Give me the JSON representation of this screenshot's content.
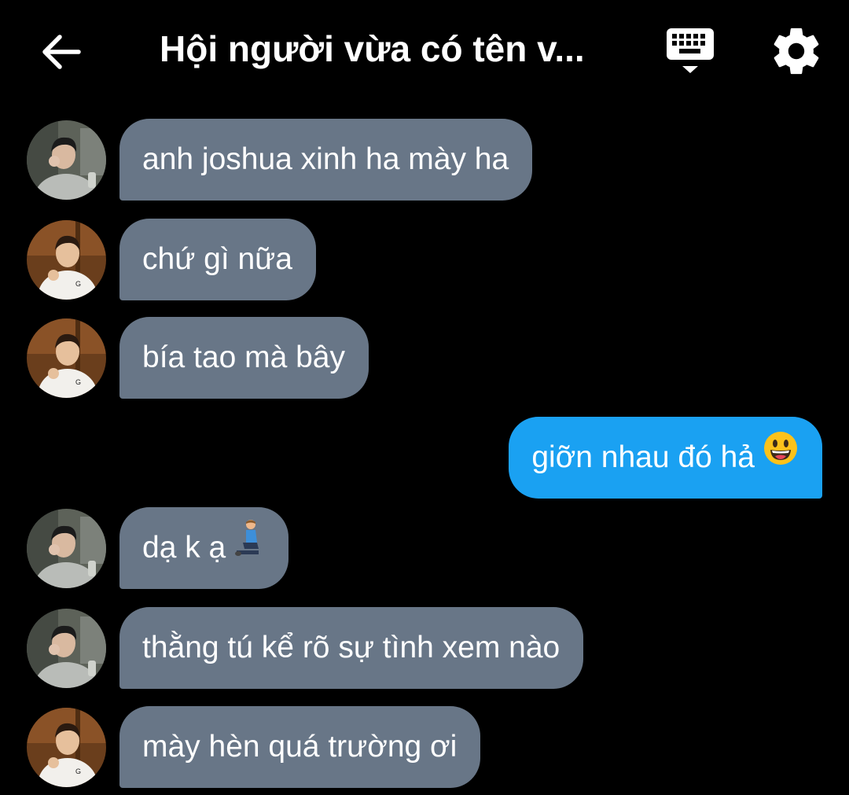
{
  "header": {
    "title": "Hội người vừa có tên v...",
    "back_icon": "arrow-left-icon",
    "keyboard_icon": "keyboard-icon",
    "settings_icon": "gear-icon"
  },
  "messages": [
    {
      "sender": "incoming",
      "avatar": "avatar-user-a",
      "text": "anh joshua xinh ha mày ha"
    },
    {
      "sender": "incoming",
      "avatar": "avatar-user-b",
      "text": "chứ gì nữa"
    },
    {
      "sender": "incoming",
      "avatar": "avatar-user-b",
      "text": "bía tao mà bây"
    },
    {
      "sender": "outgoing",
      "text": "giỡn nhau đó hả",
      "emoji": "grinning-face-emoji"
    },
    {
      "sender": "incoming",
      "avatar": "avatar-user-a",
      "text": "dạ k ạ",
      "emoji": "kneeling-person-emoji"
    },
    {
      "sender": "incoming",
      "avatar": "avatar-user-a",
      "text": "thằng tú kể rõ sự tình xem nào"
    },
    {
      "sender": "incoming",
      "avatar": "avatar-user-b",
      "text": "mày hèn quá trường ơi"
    }
  ],
  "colors": {
    "background": "#000000",
    "incoming_bubble": "#687687",
    "outgoing_bubble": "#1aa1f2",
    "text": "#ffffff"
  }
}
